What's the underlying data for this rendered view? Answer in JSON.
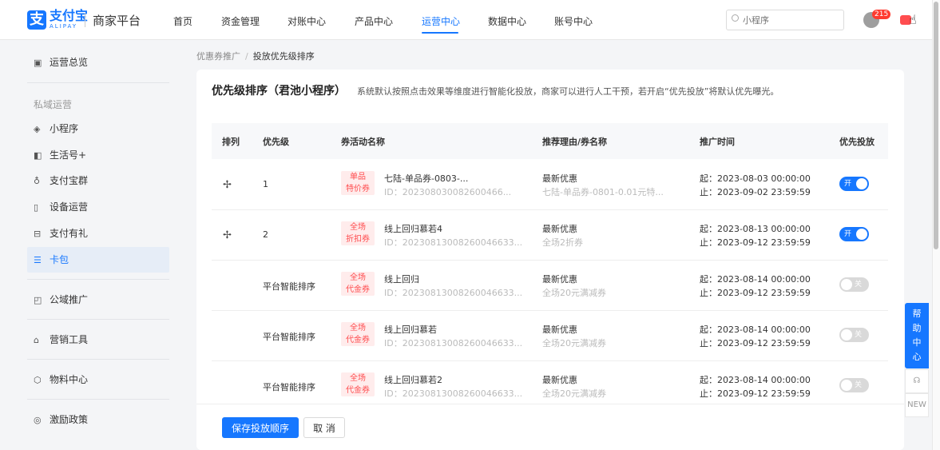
{
  "brand": {
    "logo_glyph": "支",
    "name": "支付宝",
    "sub": "ALIPAY",
    "platform": "商家平台"
  },
  "nav": {
    "items": [
      {
        "label": "首页"
      },
      {
        "label": "资金管理"
      },
      {
        "label": "对账中心"
      },
      {
        "label": "产品中心"
      },
      {
        "label": "运营中心"
      },
      {
        "label": "数据中心"
      },
      {
        "label": "账号中心"
      }
    ],
    "active": "运营中心"
  },
  "search": {
    "placeholder": "小程序"
  },
  "notifications": {
    "count": "215"
  },
  "sidebar": {
    "overview": "运营总览",
    "group_private": "私域运营",
    "items": [
      {
        "label": "小程序"
      },
      {
        "label": "生活号+"
      },
      {
        "label": "支付宝群"
      },
      {
        "label": "设备运营"
      },
      {
        "label": "支付有礼"
      },
      {
        "label": "卡包"
      }
    ],
    "public_promo": "公域推广",
    "marketing_tools": "营销工具",
    "materials": "物料中心",
    "incentive": "激励政策"
  },
  "breadcrumb": {
    "parent": "优惠券推广",
    "separator": "/",
    "current": "投放优先级排序"
  },
  "card": {
    "title": "优先级排序（君池小程序）",
    "description": "系统默认按照点击效果等维度进行智能化投放，商家可以进行人工干预，若开启“优先投放”将默认优先曝光。"
  },
  "table": {
    "headers": [
      "排列",
      "优先级",
      "券活动名称",
      "推荐理由/券名称",
      "推广时间",
      "优先投放"
    ],
    "rows": [
      {
        "drag": "✢",
        "priority": "1",
        "tag1": "单品",
        "tag2": "特价券",
        "name": "七陆-单品券-0803-...",
        "id": "ID：202308030082600466...",
        "reason": "最新优惠",
        "coupon": "七陆-单品券-0801-0.01元特...",
        "start": "起：2023-08-03 00:00:00",
        "end": "止：2023-09-02 23:59:59",
        "switch": "开",
        "on": true
      },
      {
        "drag": "✢",
        "priority": "2",
        "tag1": "全场",
        "tag2": "折扣券",
        "name": "线上回归慕若4",
        "id": "ID：20230813008260046633...",
        "reason": "最新优惠",
        "coupon": "全场2折券",
        "start": "起：2023-08-13 00:00:00",
        "end": "止：2023-09-12 23:59:59",
        "switch": "开",
        "on": true
      },
      {
        "drag": "",
        "priority": "平台智能排序",
        "tag1": "全场",
        "tag2": "代金券",
        "name": "线上回归",
        "id": "ID：20230813008260046633...",
        "reason": "最新优惠",
        "coupon": "全场20元满减券",
        "start": "起：2023-08-14 00:00:00",
        "end": "止：2023-09-12 23:59:59",
        "switch": "关",
        "on": false
      },
      {
        "drag": "",
        "priority": "平台智能排序",
        "tag1": "全场",
        "tag2": "代金券",
        "name": "线上回归慕若",
        "id": "ID：20230813008260046633...",
        "reason": "最新优惠",
        "coupon": "全场20元满减券",
        "start": "起：2023-08-14 00:00:00",
        "end": "止：2023-09-12 23:59:59",
        "switch": "关",
        "on": false
      },
      {
        "drag": "",
        "priority": "平台智能排序",
        "tag1": "全场",
        "tag2": "代金券",
        "name": "线上回归慕若2",
        "id": "ID：20230813008260046633...",
        "reason": "最新优惠",
        "coupon": "全场20元满减券",
        "start": "起：2023-08-14 00:00:00",
        "end": "止：2023-09-12 23:59:59",
        "switch": "关",
        "on": false
      }
    ]
  },
  "actions": {
    "save": "保存投放顺序",
    "cancel": "取 消"
  },
  "help": {
    "label": "帮助中心",
    "chars": [
      "帮",
      "助",
      "中",
      "心"
    ],
    "new_badge": "NEW"
  },
  "colors": {
    "primary": "#1677ff",
    "tag_bg": "#ffecec",
    "tag_text": "#ff4d4f",
    "badge": "#ff3b30"
  }
}
